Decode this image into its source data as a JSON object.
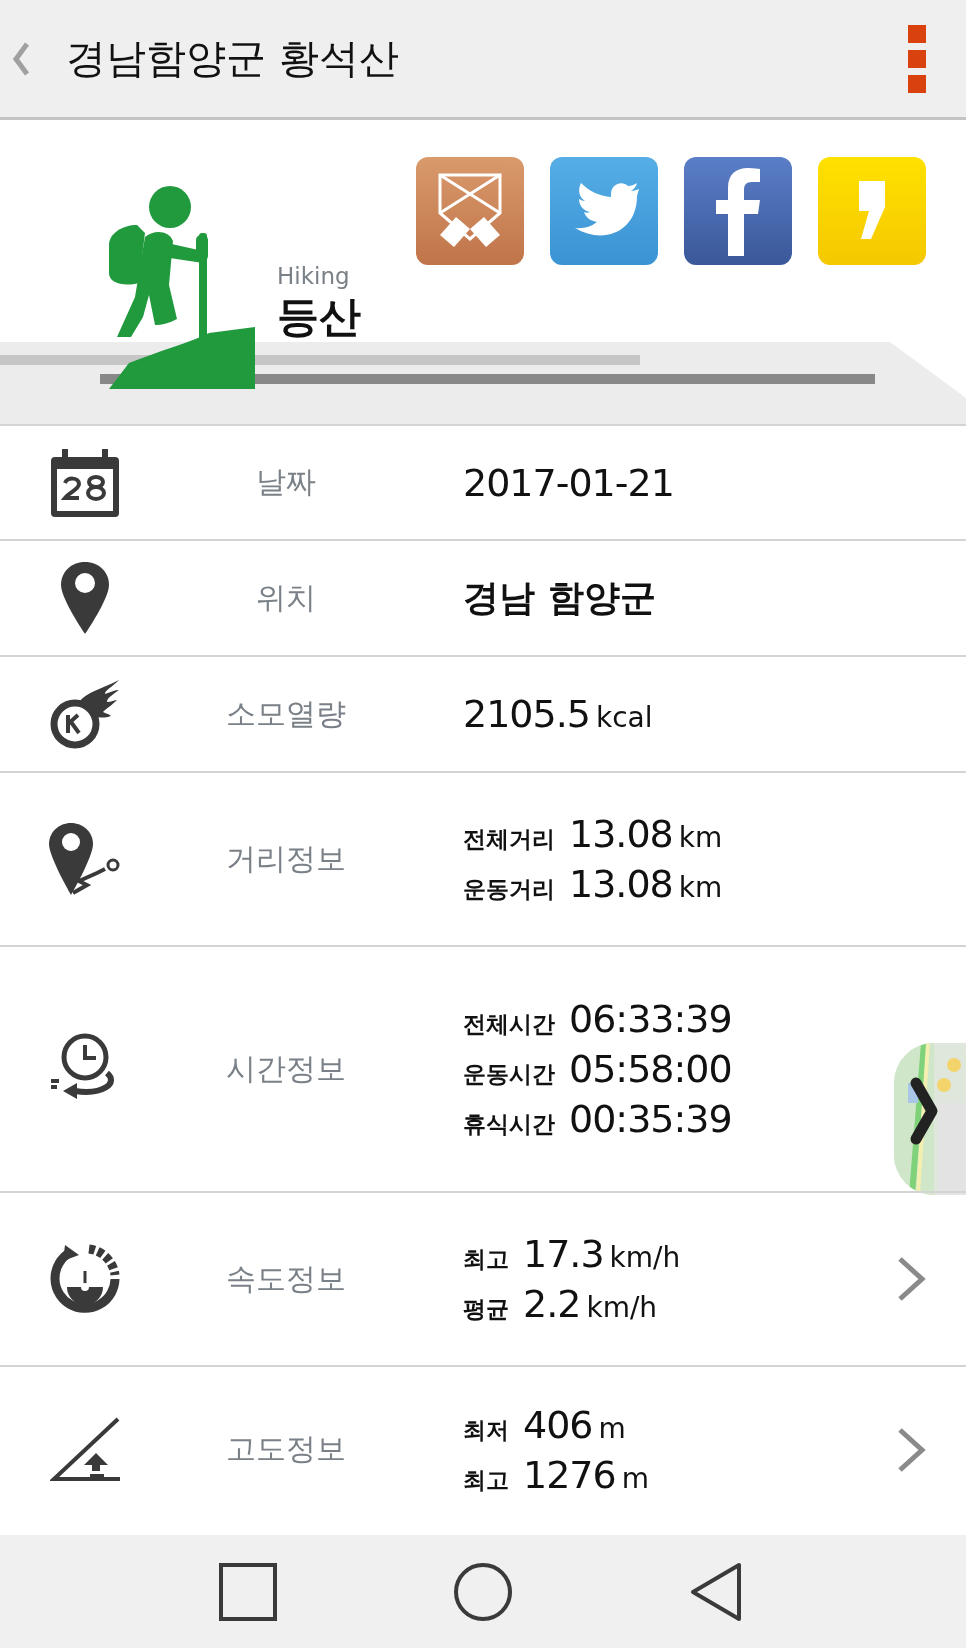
{
  "header": {
    "title": "경남함양군 황석산"
  },
  "activity": {
    "english": "Hiking",
    "name": "등산"
  },
  "rows": [
    {
      "kind": "date",
      "label": "날짜",
      "chevron": false,
      "lines": [
        {
          "number": "2017-01-21"
        }
      ]
    },
    {
      "kind": "location",
      "label": "위치",
      "chevron": false,
      "lines": [
        {
          "text": "경남 함양군"
        }
      ]
    },
    {
      "kind": "calories",
      "label": "소모열량",
      "chevron": false,
      "lines": [
        {
          "number": "2105.5",
          "unit": "kcal"
        }
      ]
    },
    {
      "kind": "distance",
      "label": "거리정보",
      "chevron": false,
      "lines": [
        {
          "label": "전체거리",
          "number": "13.08",
          "unit": "km"
        },
        {
          "label": "운동거리",
          "number": "13.08",
          "unit": "km"
        }
      ]
    },
    {
      "kind": "time",
      "label": "시간정보",
      "chevron": false,
      "map_thumbnail": true,
      "lines": [
        {
          "label": "전체시간",
          "number": "06:33:39"
        },
        {
          "label": "운동시간",
          "number": "05:58:00"
        },
        {
          "label": "휴식시간",
          "number": "00:35:39"
        }
      ]
    },
    {
      "kind": "speed",
      "label": "속도정보",
      "chevron": true,
      "lines": [
        {
          "label": "최고",
          "number": "17.3",
          "unit": "km/h"
        },
        {
          "label": "평균",
          "number": "2.2",
          "unit": "km/h"
        }
      ]
    },
    {
      "kind": "altitude",
      "label": "고도정보",
      "chevron": true,
      "lines": [
        {
          "label": "최저",
          "number": "406",
          "unit": "m"
        },
        {
          "label": "최고",
          "number": "1276",
          "unit": "m"
        }
      ]
    }
  ]
}
